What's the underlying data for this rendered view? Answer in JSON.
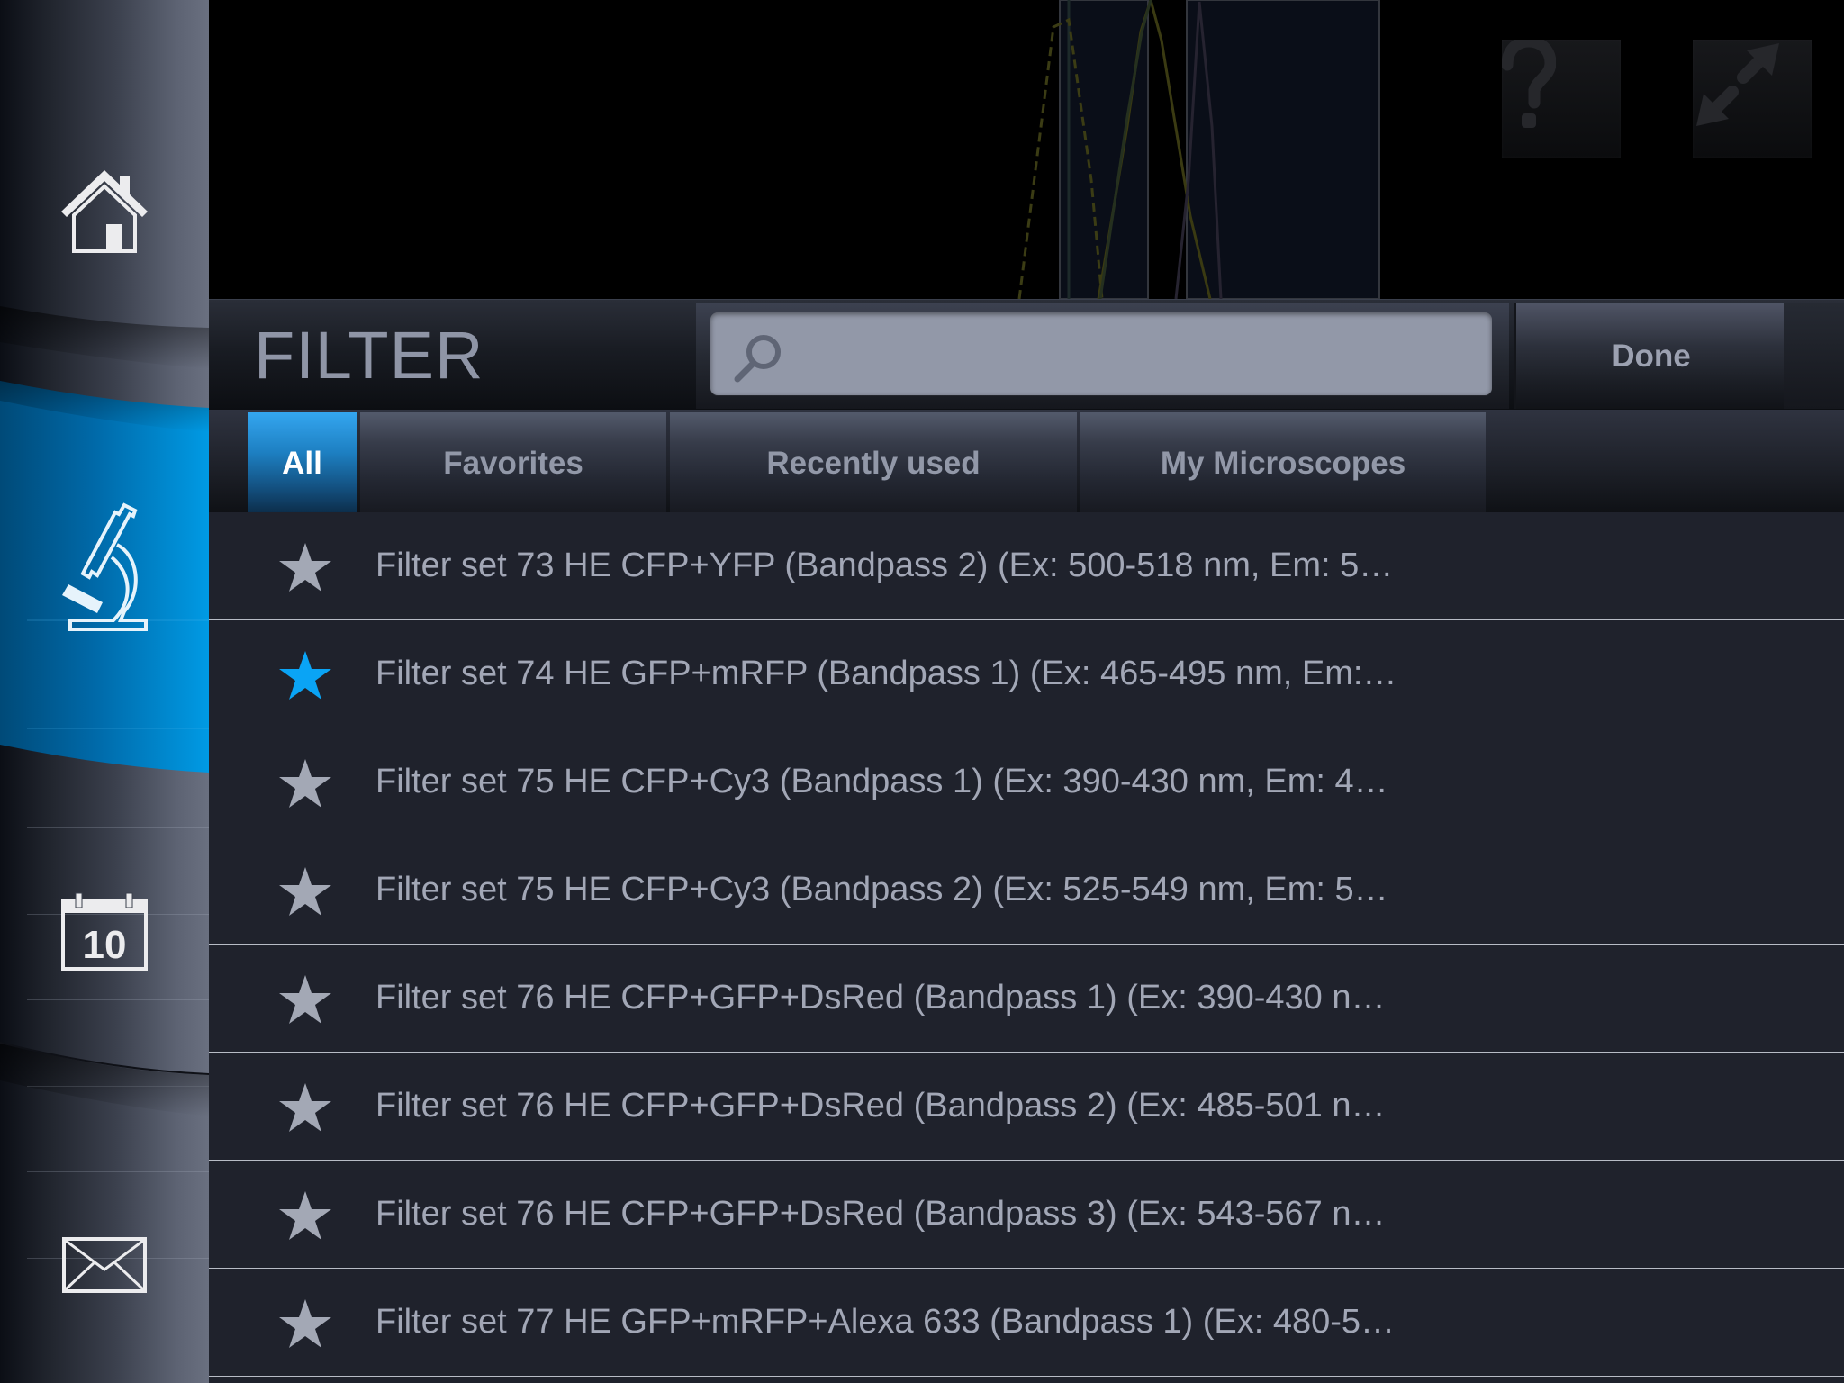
{
  "sidebar": {
    "items": [
      {
        "id": "home",
        "icon": "home-icon",
        "active": false
      },
      {
        "id": "microscope",
        "icon": "microscope-icon",
        "active": true
      },
      {
        "id": "calendar",
        "icon": "calendar-icon",
        "active": false,
        "day": "10"
      },
      {
        "id": "mail",
        "icon": "mail-icon",
        "active": false
      }
    ],
    "active_color": "#009ae4"
  },
  "background_view": {
    "help_button": {
      "icon": "question-icon",
      "glyph": "?"
    },
    "fullscreen_button": {
      "icon": "expand-arrows-icon"
    }
  },
  "header": {
    "title": "FILTER",
    "search": {
      "value": "",
      "placeholder": ""
    },
    "done_label": "Done"
  },
  "tabs": [
    {
      "label": "All",
      "active": true
    },
    {
      "label": "Favorites",
      "active": false
    },
    {
      "label": "Recently used",
      "active": false
    },
    {
      "label": "My Microscopes",
      "active": false
    }
  ],
  "filters": [
    {
      "label": "Filter set 73 HE CFP+YFP (Bandpass 2) (Ex: 500-518 nm, Em: 5…",
      "favorite": false
    },
    {
      "label": "Filter set 74 HE GFP+mRFP (Bandpass 1) (Ex: 465-495 nm, Em:…",
      "favorite": true
    },
    {
      "label": "Filter set 75 HE CFP+Cy3 (Bandpass 1) (Ex: 390-430 nm, Em: 4…",
      "favorite": false
    },
    {
      "label": "Filter set 75 HE CFP+Cy3 (Bandpass 2) (Ex: 525-549 nm, Em: 5…",
      "favorite": false
    },
    {
      "label": "Filter set 76 HE CFP+GFP+DsRed (Bandpass 1) (Ex: 390-430 n…",
      "favorite": false
    },
    {
      "label": "Filter set 76 HE CFP+GFP+DsRed (Bandpass 2) (Ex: 485-501 n…",
      "favorite": false
    },
    {
      "label": "Filter set 76 HE CFP+GFP+DsRed (Bandpass 3) (Ex: 543-567 n…",
      "favorite": false
    },
    {
      "label": "Filter set 77 HE GFP+mRFP+Alexa 633 (Bandpass 1) (Ex: 480-5…",
      "favorite": false
    }
  ],
  "colors": {
    "accent": "#009ae4",
    "star_favorite": "#0aa4f5",
    "star_default": "#a3a8b5",
    "list_bg": "#1f222c",
    "text": "#a2a7b6"
  }
}
